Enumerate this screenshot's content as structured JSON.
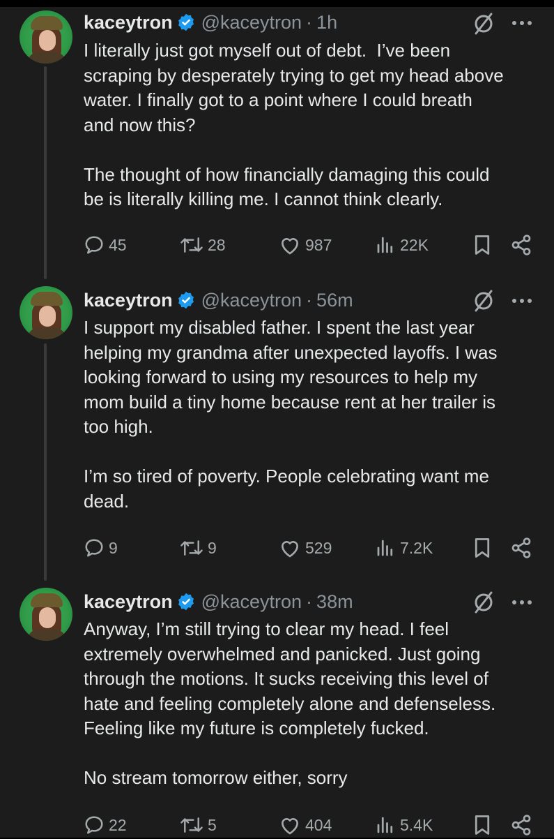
{
  "tweets": [
    {
      "name": "kaceytron",
      "handle": "@kaceytron",
      "time": "1h",
      "text": "I literally just got myself out of debt.  I’ve been\nscraping by desperately trying to get my head above\nwater. I finally got to a point where I could breath\nand now this?\n\nThe thought of how financially damaging this could\nbe is literally killing me. I cannot think clearly.",
      "replies": "45",
      "retweets": "28",
      "likes": "987",
      "views": "22K"
    },
    {
      "name": "kaceytron",
      "handle": "@kaceytron",
      "time": "56m",
      "text": "I support my disabled father. I spent the last year\nhelping my grandma after unexpected layoffs. I was\nlooking forward to using my resources to help my\nmom build a tiny home because rent at her trailer is\ntoo high.\n\nI’m so tired of poverty. People celebrating want me\ndead.",
      "replies": "9",
      "retweets": "9",
      "likes": "529",
      "views": "7.2K"
    },
    {
      "name": "kaceytron",
      "handle": "@kaceytron",
      "time": "38m",
      "text": "Anyway, I’m still trying to clear my head. I feel\nextremely overwhelmed and panicked. Just going\nthrough the motions. It sucks receiving this level of\nhate and feeling completely alone and defenseless.\nFeeling like my future is completely fucked.\n\nNo stream tomorrow either, sorry",
      "replies": "22",
      "retweets": "5",
      "likes": "404",
      "views": "5.4K"
    }
  ],
  "icons": {
    "verified": "verified-badge-icon",
    "edit": "edited-icon",
    "more": "more-icon",
    "reply": "reply-icon",
    "retweet": "retweet-icon",
    "like": "like-icon",
    "views": "views-icon",
    "bookmark": "bookmark-icon",
    "share": "share-icon"
  },
  "colors": {
    "background": "#1c1c1c",
    "text": "#e7e9ea",
    "secondary": "#8b949a",
    "verified": "#1d9bf0"
  }
}
